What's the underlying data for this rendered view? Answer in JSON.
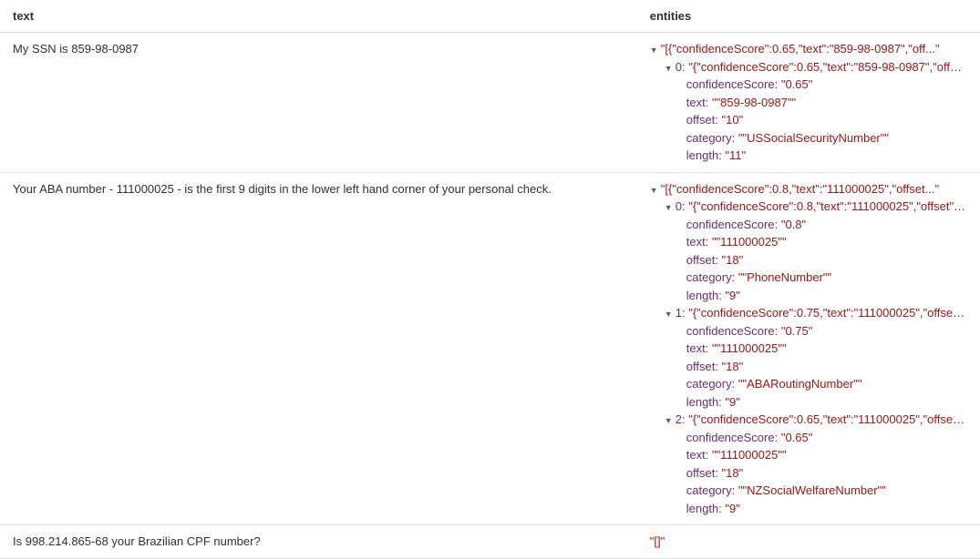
{
  "columns": {
    "text": "text",
    "entities": "entities"
  },
  "rows": [
    {
      "text": "My SSN is 859-98-0987",
      "entities": {
        "root_preview": "\"[{\"confidenceScore\":0.65,\"text\":\"859-98-0987\",\"off...\"",
        "items": [
          {
            "preview": "\"{\"confidenceScore\":0.65,\"text\":\"859-98-0987\",\"offs...\"",
            "props": {
              "confidenceScore": "\"0.65\"",
              "text": "\"\"859-98-0987\"\"",
              "offset": "\"10\"",
              "category": "\"\"USSocialSecurityNumber\"\"",
              "length": "\"11\""
            }
          }
        ]
      }
    },
    {
      "text": "Your ABA number - 111000025 - is the first 9 digits in the lower left hand corner of your personal check.",
      "entities": {
        "root_preview": "\"[{\"confidenceScore\":0.8,\"text\":\"111000025\",\"offset...\"",
        "items": [
          {
            "preview": "\"{\"confidenceScore\":0.8,\"text\":\"111000025\",\"offset\"...\"",
            "props": {
              "confidenceScore": "\"0.8\"",
              "text": "\"\"111000025\"\"",
              "offset": "\"18\"",
              "category": "\"\"PhoneNumber\"\"",
              "length": "\"9\""
            }
          },
          {
            "preview": "\"{\"confidenceScore\":0.75,\"text\":\"111000025\",\"offset...\"",
            "props": {
              "confidenceScore": "\"0.75\"",
              "text": "\"\"111000025\"\"",
              "offset": "\"18\"",
              "category": "\"\"ABARoutingNumber\"\"",
              "length": "\"9\""
            }
          },
          {
            "preview": "\"{\"confidenceScore\":0.65,\"text\":\"111000025\",\"offset...\"",
            "props": {
              "confidenceScore": "\"0.65\"",
              "text": "\"\"111000025\"\"",
              "offset": "\"18\"",
              "category": "\"\"NZSocialWelfareNumber\"\"",
              "length": "\"9\""
            }
          }
        ]
      }
    },
    {
      "text": "Is 998.214.865-68 your Brazilian CPF number?",
      "entities": {
        "empty": "\"[]\""
      }
    }
  ]
}
